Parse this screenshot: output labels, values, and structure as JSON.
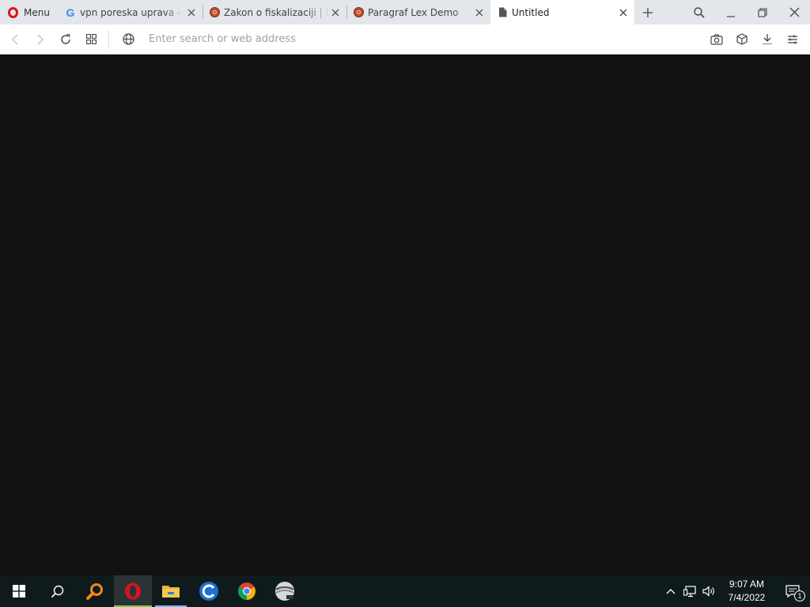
{
  "browser": {
    "menu_label": "Menu",
    "tabs": [
      {
        "title": "vpn poreska uprava - Google Search",
        "favicon": "google-icon",
        "active": false
      },
      {
        "title": "Zakon o fiskalizaciji | Repub",
        "favicon": "paragraf-icon",
        "active": false
      },
      {
        "title": "Paragraf Lex Demo",
        "favicon": "paragraf-icon",
        "active": false
      },
      {
        "title": "Untitled",
        "favicon": "document-icon",
        "active": true
      }
    ],
    "address_placeholder": "Enter search or web address",
    "address_value": ""
  },
  "taskbar": {
    "apps": [
      {
        "name": "search-everything",
        "running": false
      },
      {
        "name": "opera",
        "running": true,
        "active": true
      },
      {
        "name": "file-explorer",
        "running": true
      },
      {
        "name": "edge-app",
        "running": false
      },
      {
        "name": "chrome",
        "running": false
      },
      {
        "name": "disc-app",
        "running": false
      }
    ],
    "clock": {
      "time": "9:07 AM",
      "date": "7/4/2022"
    },
    "notification_count": "1"
  },
  "colors": {
    "tabstrip_bg": "#e3e6ea",
    "active_tab_bg": "#ffffff",
    "content_bg": "#121111",
    "taskbar_bg": "#0f1a1d",
    "opera_red": "#d8141d",
    "running_indicator": "#76b9ed",
    "active_indicator": "#8bc34a"
  }
}
